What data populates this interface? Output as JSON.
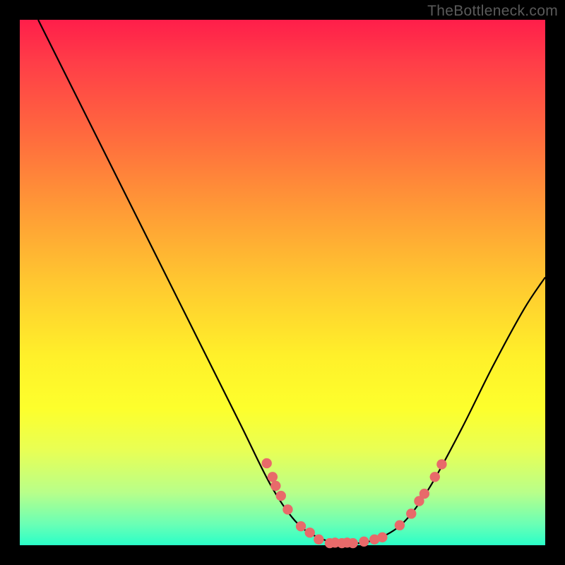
{
  "watermark": "TheBottleneck.com",
  "colors": {
    "curve_stroke": "#000000",
    "point_fill": "#e86a6a",
    "point_stroke": "#c94f4f",
    "background_frame": "#000000"
  },
  "chart_data": {
    "type": "line",
    "title": "",
    "xlabel": "",
    "ylabel": "",
    "xlim": [
      0,
      100
    ],
    "ylim": [
      0,
      100
    ],
    "bands_note": "vertical gradient encodes bottleneck percentage: red≈100 at top, green≈0 at bottom",
    "curve": [
      {
        "x": 3.5,
        "y": 100
      },
      {
        "x": 10,
        "y": 87
      },
      {
        "x": 18,
        "y": 71
      },
      {
        "x": 26,
        "y": 55
      },
      {
        "x": 34,
        "y": 39
      },
      {
        "x": 42,
        "y": 23
      },
      {
        "x": 48,
        "y": 11
      },
      {
        "x": 53,
        "y": 4
      },
      {
        "x": 58,
        "y": 1
      },
      {
        "x": 63,
        "y": 0.3
      },
      {
        "x": 68,
        "y": 1.2
      },
      {
        "x": 73,
        "y": 4.3
      },
      {
        "x": 78,
        "y": 11
      },
      {
        "x": 84,
        "y": 22
      },
      {
        "x": 90,
        "y": 34
      },
      {
        "x": 96,
        "y": 45
      },
      {
        "x": 100,
        "y": 51
      }
    ],
    "points": [
      {
        "x": 47.0,
        "y": 15.6
      },
      {
        "x": 48.1,
        "y": 13.0
      },
      {
        "x": 48.7,
        "y": 11.3
      },
      {
        "x": 49.7,
        "y": 9.4
      },
      {
        "x": 51.0,
        "y": 6.8
      },
      {
        "x": 53.5,
        "y": 3.6
      },
      {
        "x": 55.2,
        "y": 2.4
      },
      {
        "x": 56.9,
        "y": 1.1
      },
      {
        "x": 59.0,
        "y": 0.4
      },
      {
        "x": 60.0,
        "y": 0.5
      },
      {
        "x": 61.3,
        "y": 0.4
      },
      {
        "x": 62.3,
        "y": 0.5
      },
      {
        "x": 63.4,
        "y": 0.4
      },
      {
        "x": 65.5,
        "y": 0.7
      },
      {
        "x": 67.5,
        "y": 1.1
      },
      {
        "x": 69.0,
        "y": 1.5
      },
      {
        "x": 72.3,
        "y": 3.8
      },
      {
        "x": 74.5,
        "y": 6.0
      },
      {
        "x": 76.0,
        "y": 8.4
      },
      {
        "x": 77.0,
        "y": 9.8
      },
      {
        "x": 79.0,
        "y": 13.0
      },
      {
        "x": 80.3,
        "y": 15.4
      }
    ]
  }
}
